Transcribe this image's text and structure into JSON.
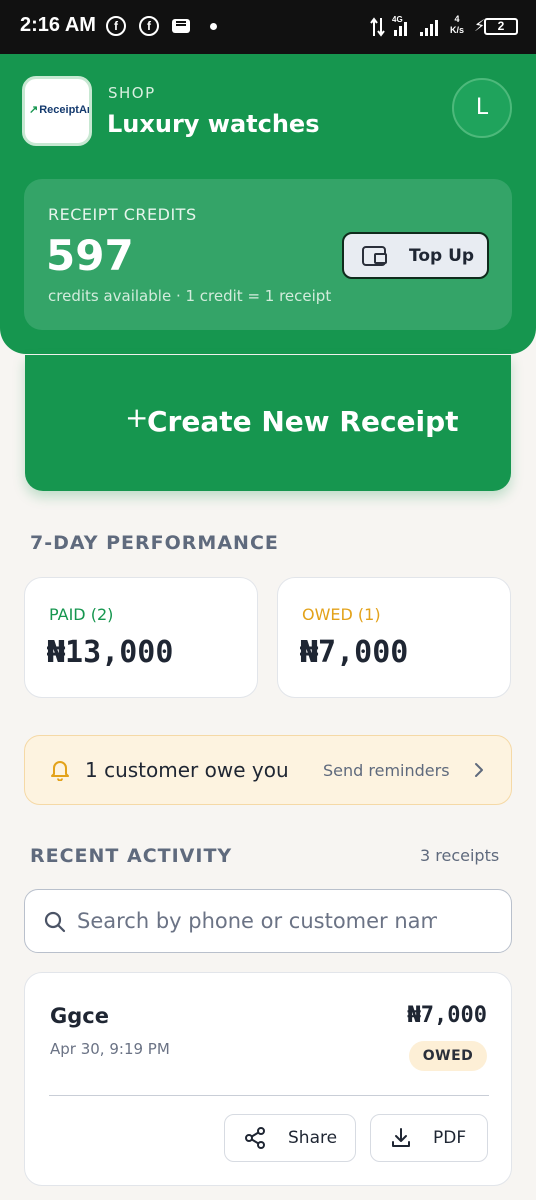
{
  "status_bar": {
    "time": "2:16 AM",
    "network_label": "4G",
    "speed_value": "4",
    "speed_unit": "K/s",
    "battery": "2",
    "icons": [
      "facebook-icon",
      "facebook-icon",
      "message-icon",
      "notification-dot",
      "data-arrows-icon",
      "signal-icon",
      "charging-icon",
      "battery-icon"
    ]
  },
  "header": {
    "logo_text": "ReceiptAn",
    "shop_label": "SHOP",
    "shop_name": "Luxury watches",
    "avatar_initial": "L"
  },
  "credits": {
    "label": "RECEIPT CREDITS",
    "value": "597",
    "note": "credits available · 1 credit = 1 receipt",
    "top_up_label": "Top Up"
  },
  "create_button": {
    "icon": "+",
    "label": "Create New Receipt"
  },
  "performance": {
    "title": "7-DAY PERFORMANCE",
    "paid": {
      "label": "PAID (2)",
      "value": "₦13,000"
    },
    "owed": {
      "label": "OWED (1)",
      "value": "₦7,000"
    }
  },
  "reminder": {
    "text": "1 customer owe you",
    "link": "Send reminders"
  },
  "recent": {
    "title": "RECENT ACTIVITY",
    "count": "3 receipts",
    "search_placeholder": "Search by phone or customer name",
    "receipts": [
      {
        "name": "Ggce",
        "date": "Apr 30, 9:19 PM",
        "amount": "₦7,000",
        "status": "OWED",
        "share_label": "Share",
        "pdf_label": "PDF"
      }
    ]
  },
  "colors": {
    "brand_green": "#16964f",
    "paid_green": "#16964f",
    "owed_amber": "#e3a21a",
    "background": "#f7f5f2"
  }
}
